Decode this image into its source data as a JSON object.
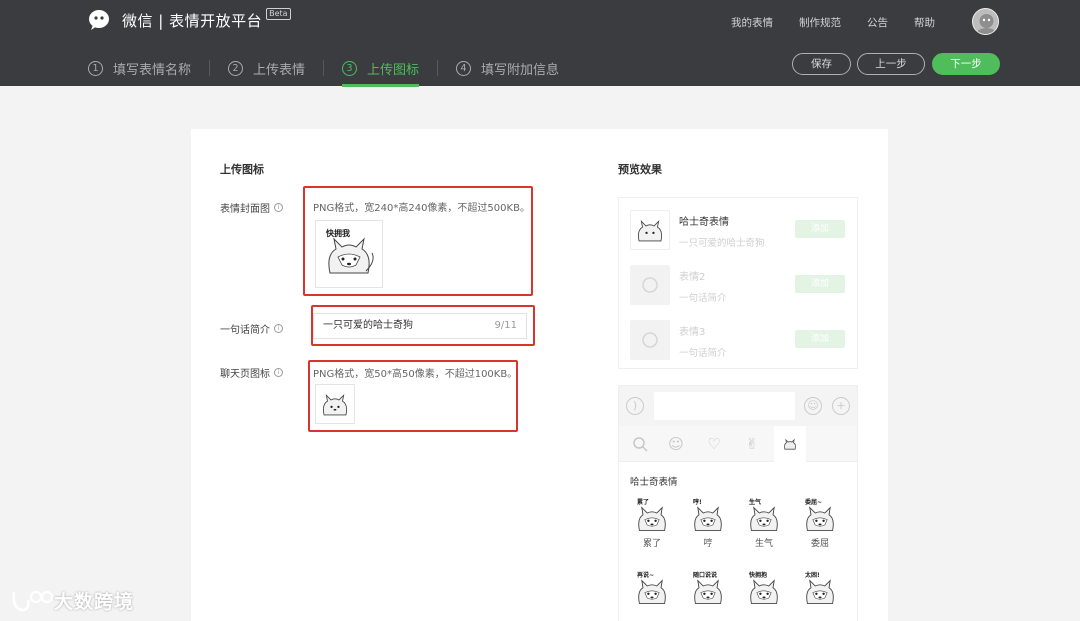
{
  "brand": {
    "title": "微信 | 表情开放平台",
    "badge": "Beta"
  },
  "top_nav": [
    "我的表情",
    "制作规范",
    "公告",
    "帮助"
  ],
  "steps": [
    {
      "num": "1",
      "label": "填写表情名称"
    },
    {
      "num": "2",
      "label": "上传表情"
    },
    {
      "num": "3",
      "label": "上传图标"
    },
    {
      "num": "4",
      "label": "填写附加信息"
    }
  ],
  "actions": {
    "save": "保存",
    "prev": "上一步",
    "next": "下一步"
  },
  "form": {
    "section_title": "上传图标",
    "cover": {
      "label": "表情封面图",
      "hint": "PNG格式，宽240*高240像素，不超过500KB。"
    },
    "intro": {
      "label": "一句话简介",
      "value": "一只可爱的哈士奇狗",
      "count": "9/11"
    },
    "chat_icon": {
      "label": "聊天页图标",
      "hint": "PNG格式，宽50*高50像素，不超过100KB。"
    }
  },
  "preview": {
    "title": "预览效果",
    "list": [
      {
        "name": "哈士奇表情",
        "desc": "一只可爱的哈士奇狗",
        "button": "添加"
      },
      {
        "name": "表情2",
        "desc": "一句话简介",
        "button": "添加"
      },
      {
        "name": "表情3",
        "desc": "一句话简介",
        "button": "添加"
      }
    ],
    "pack_title": "哈士奇表情",
    "stickers": [
      {
        "text": "累了",
        "caption": "累了"
      },
      {
        "text": "哼!",
        "caption": "哼"
      },
      {
        "text": "生气",
        "caption": "生气"
      },
      {
        "text": "委屈~",
        "caption": "委屈"
      },
      {
        "text": "再说~",
        "caption": ""
      },
      {
        "text": "随口说说",
        "caption": ""
      },
      {
        "text": "快拥抱",
        "caption": ""
      },
      {
        "text": "太困!",
        "caption": ""
      }
    ]
  },
  "cover_sticker_text": "快拥我",
  "watermark": "大数跨境",
  "colors": {
    "header_bg": "#3a3c3f",
    "accent_green": "#4fbd5b",
    "highlight_red": "#d9352c"
  }
}
